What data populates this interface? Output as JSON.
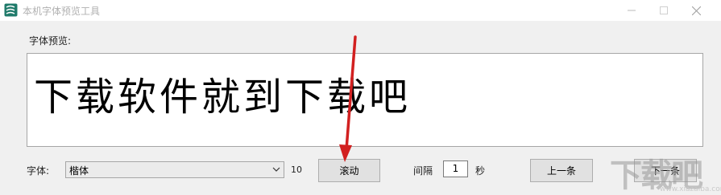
{
  "window": {
    "title": "本机字体预览工具",
    "icon": "app-logo-icon",
    "controls": [
      "minimize-icon",
      "maximize-icon",
      "close-icon"
    ]
  },
  "preview": {
    "label": "字体预览:",
    "sample_text": "下载软件就到下载吧"
  },
  "controls": {
    "font_label": "字体:",
    "font_selected": "楷体",
    "font_size": "10",
    "scroll_button": "滚动",
    "interval_label": "间隔",
    "interval_value": "1",
    "seconds_label": "秒",
    "prev_button": "上一条",
    "next_button": "下一条"
  },
  "watermark": {
    "text": "下载吧",
    "url": "www.xiazaiba.com"
  },
  "colors": {
    "annotation_arrow": "#d22020",
    "window_bg": "#f0f0f0",
    "titlebar_bg": "#ffffff"
  }
}
